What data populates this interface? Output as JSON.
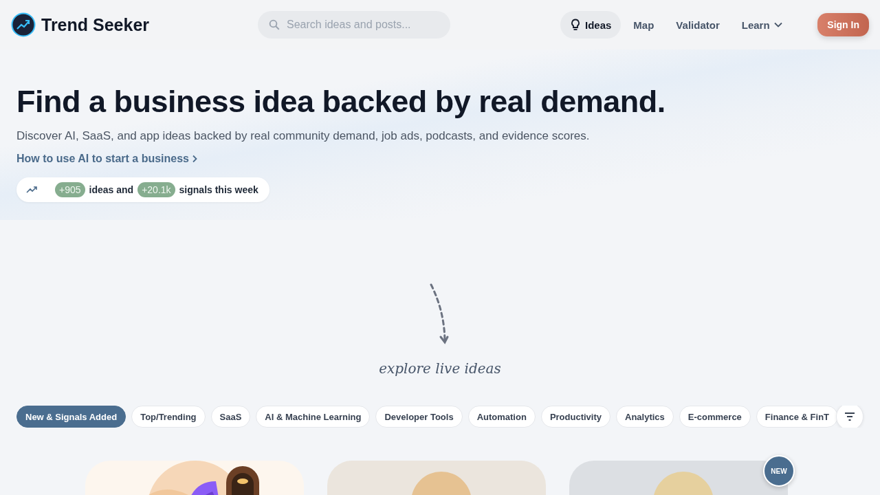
{
  "brand": {
    "name": "Trend Seeker"
  },
  "search": {
    "placeholder": "Search ideas and posts..."
  },
  "nav": [
    {
      "label": "Ideas",
      "kind": "icon",
      "selected": true
    },
    {
      "label": "Map",
      "kind": "plain",
      "selected": false
    },
    {
      "label": "Validator",
      "kind": "plain",
      "selected": false
    },
    {
      "label": "Learn",
      "kind": "dropdown",
      "selected": false
    }
  ],
  "sign_in": "Sign In",
  "hero": {
    "title": "Find a business idea backed by real demand.",
    "subtitle": "Discover AI, SaaS, and app ideas backed by real community demand, job ads, podcasts, and evidence scores.",
    "link": "How to use AI to start a business"
  },
  "stats": [
    {
      "kind": "badge",
      "text": "+905"
    },
    {
      "kind": "text",
      "text": "ideas and"
    },
    {
      "kind": "badge",
      "text": "+20.1k"
    },
    {
      "kind": "text",
      "text": "signals this week"
    }
  ],
  "explore": "explore live ideas",
  "categories": [
    {
      "label": "New & Signals Added",
      "selected": true
    },
    {
      "label": "Top/Trending",
      "selected": false
    },
    {
      "label": "SaaS",
      "selected": false
    },
    {
      "label": "AI & Machine Learning",
      "selected": false
    },
    {
      "label": "Developer Tools",
      "selected": false
    },
    {
      "label": "Automation",
      "selected": false
    },
    {
      "label": "Productivity",
      "selected": false
    },
    {
      "label": "Analytics",
      "selected": false
    },
    {
      "label": "E-commerce",
      "selected": false
    },
    {
      "label": "Finance & FinT",
      "selected": false
    }
  ],
  "cards": [
    {
      "kind": "picture",
      "new": false
    },
    {
      "kind": "picture",
      "new": false
    },
    {
      "kind": "picture",
      "new": true,
      "badge": "NEW"
    }
  ]
}
